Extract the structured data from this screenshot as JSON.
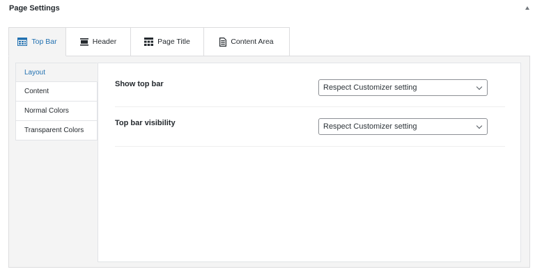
{
  "panel": {
    "title": "Page Settings",
    "toggle_icon": "arrow-up-icon"
  },
  "tabs": [
    {
      "label": "Top Bar",
      "icon": "top-bar-icon",
      "active": true
    },
    {
      "label": "Header",
      "icon": "header-icon",
      "active": false
    },
    {
      "label": "Page Title",
      "icon": "page-title-icon",
      "active": false
    },
    {
      "label": "Content Area",
      "icon": "content-area-icon",
      "active": false
    }
  ],
  "sidebar": {
    "items": [
      {
        "label": "Layout",
        "active": true
      },
      {
        "label": "Content",
        "active": false
      },
      {
        "label": "Normal Colors",
        "active": false
      },
      {
        "label": "Transparent Colors",
        "active": false
      }
    ]
  },
  "fields": [
    {
      "label": "Show top bar",
      "value": "Respect Customizer setting"
    },
    {
      "label": "Top bar visibility",
      "value": "Respect Customizer setting"
    }
  ],
  "colors": {
    "accent": "#2271b1",
    "text": "#23282d",
    "border": "#dcdcde",
    "panel_bg": "#f4f4f4"
  }
}
